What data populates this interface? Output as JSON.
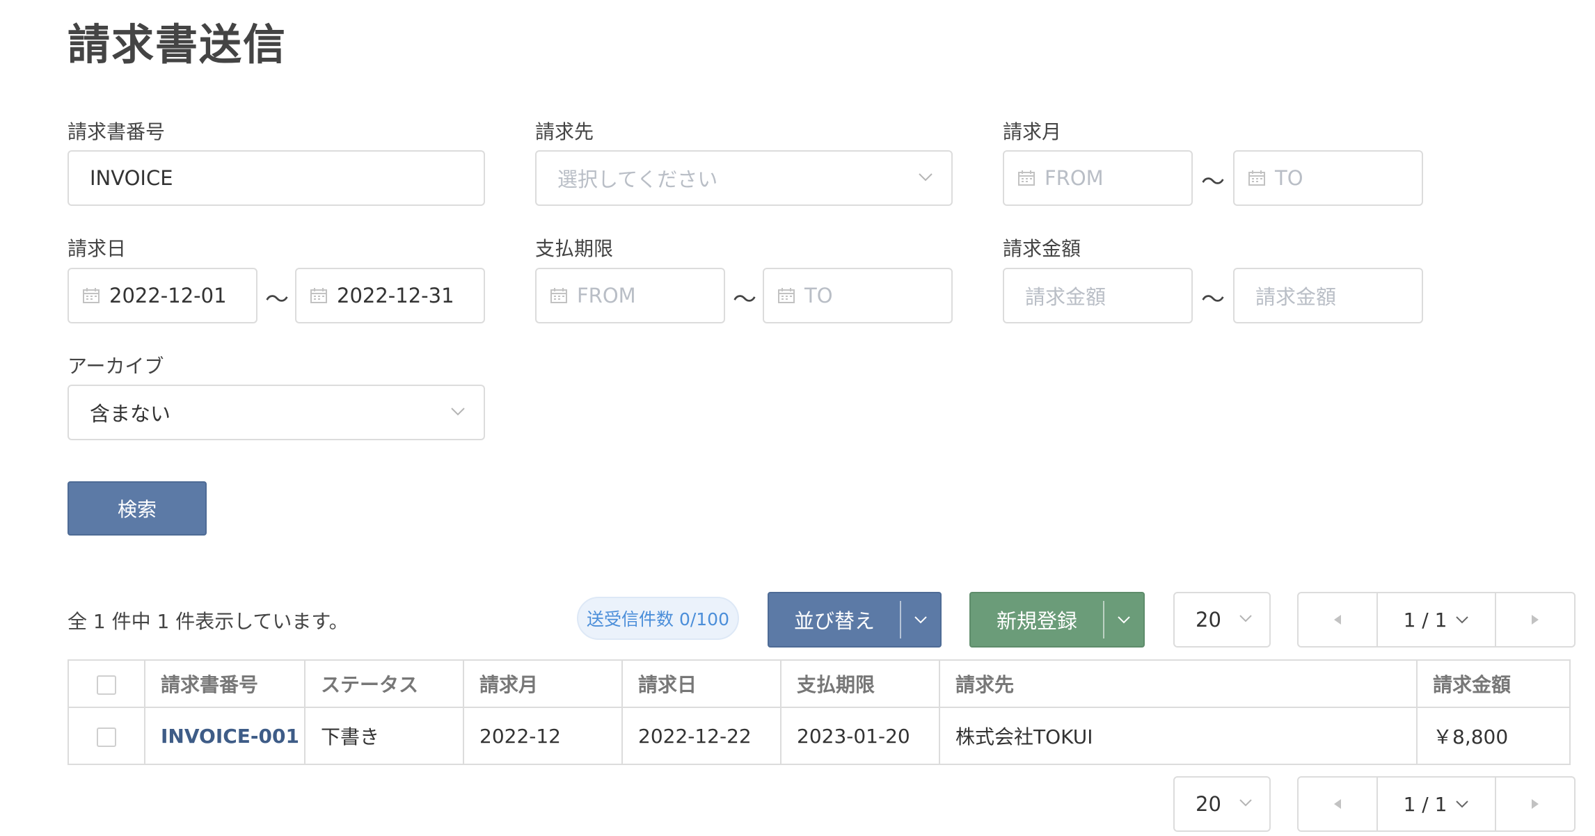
{
  "page": {
    "title": "請求書送信"
  },
  "filters": {
    "invoice_number": {
      "label": "請求書番号",
      "value": "INVOICE"
    },
    "billing_to": {
      "label": "請求先",
      "placeholder": "選択してください"
    },
    "billing_month": {
      "label": "請求月",
      "from_placeholder": "FROM",
      "to_placeholder": "TO"
    },
    "billing_date": {
      "label": "請求日",
      "from_value": "2022-12-01",
      "to_value": "2022-12-31"
    },
    "payment_due": {
      "label": "支払期限",
      "from_placeholder": "FROM",
      "to_placeholder": "TO"
    },
    "billing_amount": {
      "label": "請求金額",
      "from_placeholder": "請求金額",
      "to_placeholder": "請求金額"
    },
    "archive": {
      "label": "アーカイブ",
      "value": "含まない"
    },
    "range_separator": "〜"
  },
  "search_button": {
    "label": "検索"
  },
  "results": {
    "summary": "全 1 件中 1 件表示しています。",
    "send_count_badge": "送受信件数 0/100",
    "sort_button": "並び替え",
    "new_button": "新規登録",
    "per_page": "20",
    "page_indicator": "1 / 1"
  },
  "table": {
    "columns": [
      "請求書番号",
      "ステータス",
      "請求月",
      "請求日",
      "支払期限",
      "請求先",
      "請求金額"
    ],
    "rows": [
      [
        "INVOICE-001",
        "下書き",
        "2022-12",
        "2022-12-22",
        "2023-01-20",
        "株式会社TOKUI",
        "￥8,800"
      ]
    ]
  },
  "colors": {
    "primary": "#5c7aa6",
    "success": "#6b9c79",
    "badge_text": "#4b8ed9",
    "link": "#3e5c87"
  }
}
